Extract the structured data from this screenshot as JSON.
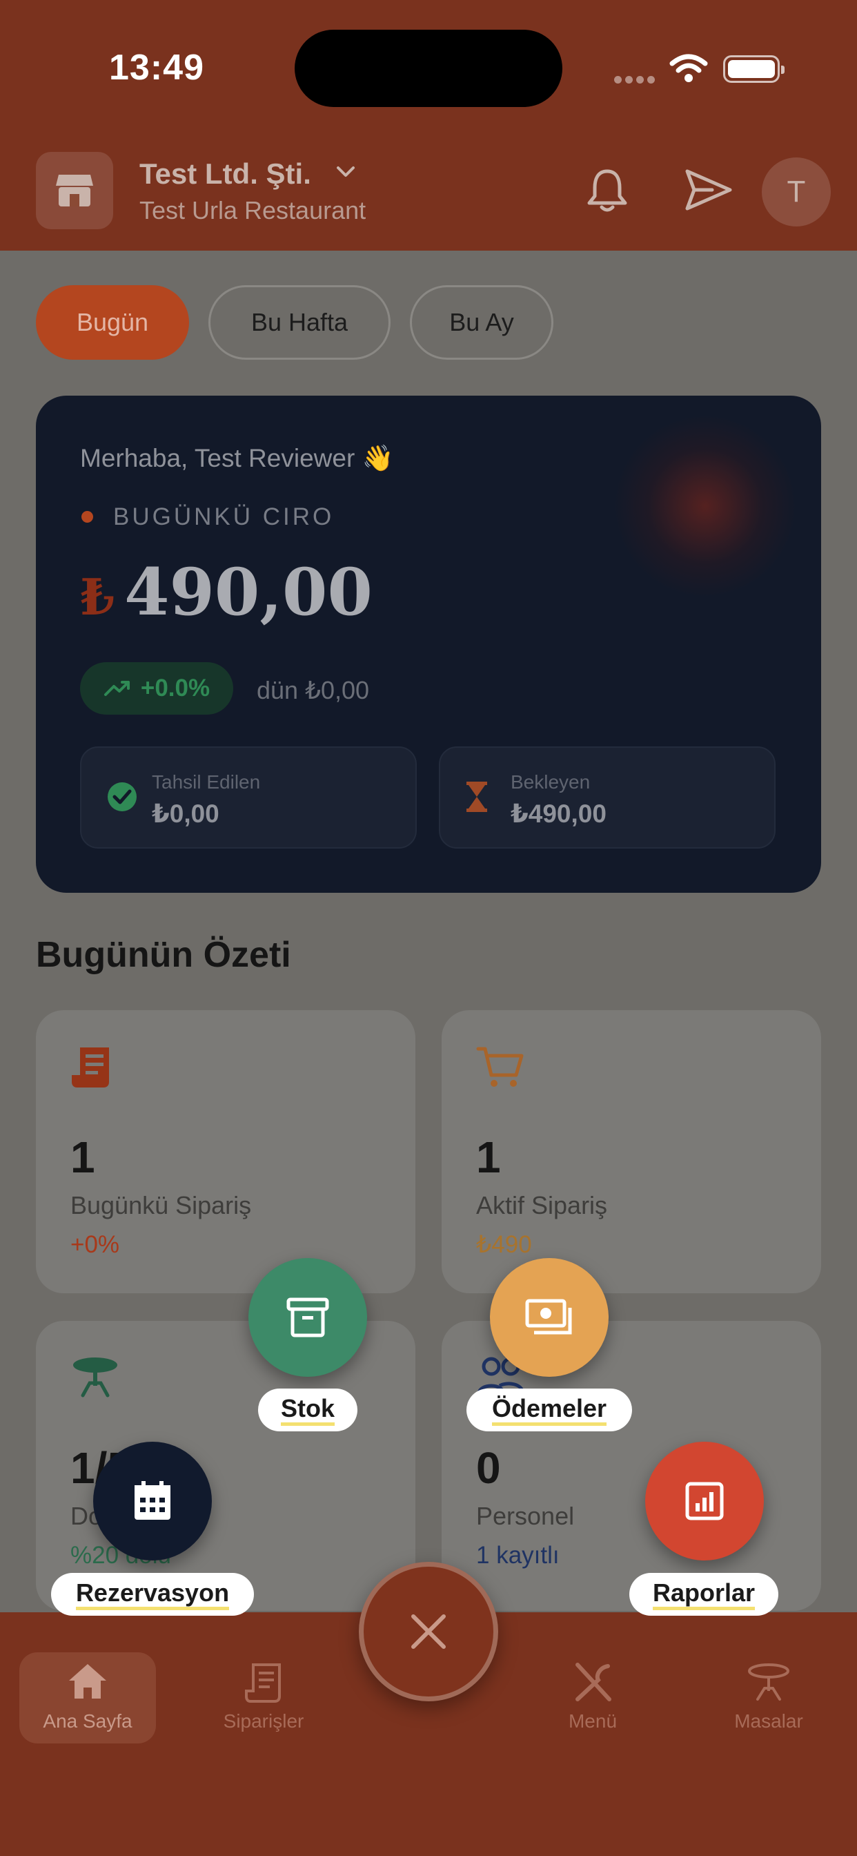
{
  "status_bar": {
    "time": "13:49"
  },
  "header": {
    "business_name": "Test Ltd. Şti.",
    "branch_name": "Test Urla Restaurant",
    "avatar_initial": "T"
  },
  "period_filter": {
    "options": [
      "Bugün",
      "Bu Hafta",
      "Bu Ay"
    ],
    "selected": "Bugün"
  },
  "revenue_card": {
    "greeting": "Merhaba, Test Reviewer 👋",
    "label": "BUGÜNKÜ CIRO",
    "currency_symbol": "₺",
    "amount": "490,00",
    "trend": "+0.0%",
    "yesterday": "dün ₺0,00",
    "collected_label": "Tahsil Edilen",
    "collected_value": "₺0,00",
    "pending_label": "Bekleyen",
    "pending_value": "₺490,00"
  },
  "summary": {
    "title": "Bugünün Özeti",
    "cards": [
      {
        "value": "1",
        "label": "Bugünkü Sipariş",
        "sub": "+0%",
        "sub_color": "#a8391a",
        "icon": "receipt-icon"
      },
      {
        "value": "1",
        "label": "Aktif Sipariş",
        "sub": "₺490",
        "sub_color": "#a8732d",
        "icon": "cart-icon"
      },
      {
        "value": "1/5",
        "label": "Dolu Masa",
        "sub": "%20 dolu",
        "sub_color": "#2b6b4c",
        "icon": "table-icon"
      },
      {
        "value": "0",
        "label": "Personel",
        "sub": "1 kayıtlı",
        "sub_color": "#1f3363",
        "icon": "people-icon"
      }
    ]
  },
  "quick_actions": [
    {
      "label": "Stok",
      "color": "#3d8a68",
      "icon": "archive-icon"
    },
    {
      "label": "Ödemeler",
      "color": "#e4a353",
      "icon": "money-icon"
    },
    {
      "label": "Rezervasyon",
      "color": "#111a2d",
      "icon": "calendar-icon"
    },
    {
      "label": "Raporlar",
      "color": "#d24630",
      "icon": "report-icon"
    }
  ],
  "bottom_nav": {
    "items": [
      "Ana Sayfa",
      "Siparişler",
      "Menü",
      "Masalar"
    ],
    "active": "Ana Sayfa"
  },
  "colors": {
    "brand": "#b4461f",
    "header_bg": "#7a321e",
    "revenue_card_bg": "#121929"
  }
}
